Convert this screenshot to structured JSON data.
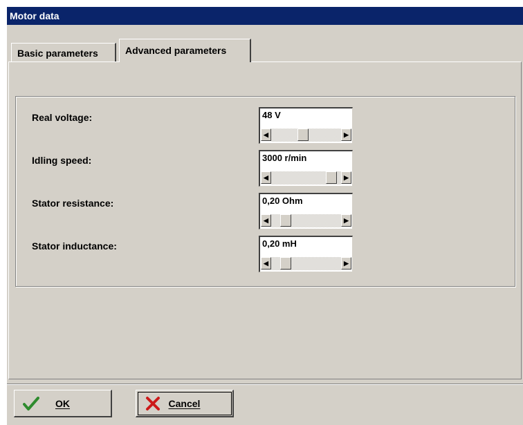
{
  "window": {
    "title": "Motor data"
  },
  "tabs": [
    {
      "label": "Basic parameters",
      "active": false
    },
    {
      "label": "Advanced parameters",
      "active": true
    }
  ],
  "parameters": [
    {
      "label": "Real voltage:",
      "value": "48 V",
      "slider_position": 0.45
    },
    {
      "label": "Idling speed:",
      "value": "3000 r/min",
      "slider_position": 0.93
    },
    {
      "label": "Stator resistance:",
      "value": "0,20 Ohm",
      "slider_position": 0.15
    },
    {
      "label": "Stator inductance:",
      "value": "0,20 mH",
      "slider_position": 0.15
    }
  ],
  "buttons": {
    "ok": {
      "label": "OK",
      "icon": "checkmark-icon",
      "color": "#2e8b2e"
    },
    "cancel": {
      "label": "Cancel",
      "icon": "x-icon",
      "color": "#cc1a1a"
    }
  }
}
